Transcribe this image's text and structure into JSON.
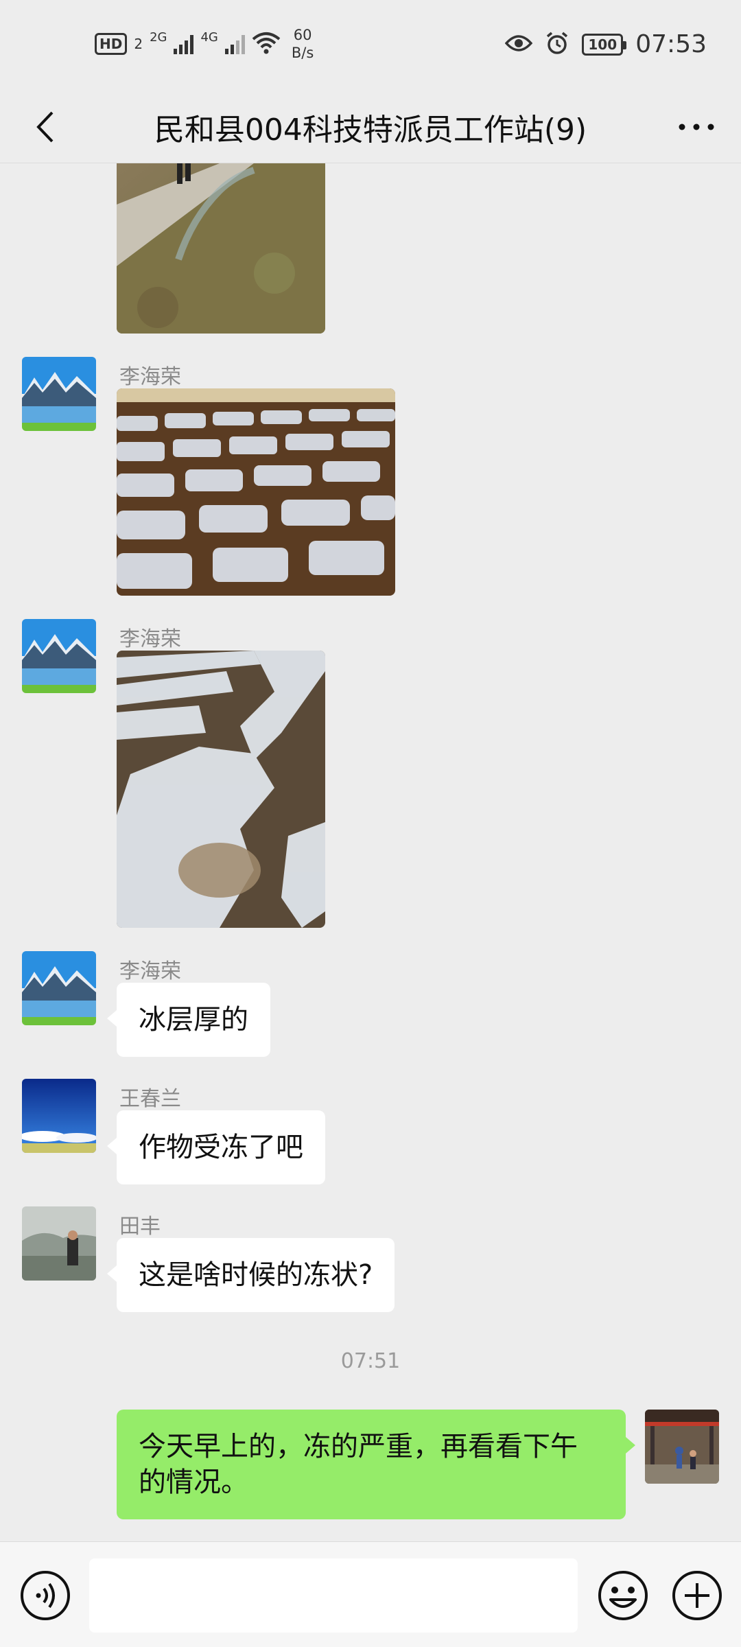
{
  "status_bar": {
    "hd": "HD",
    "sim": "2",
    "net1": "2G",
    "net2": "4G",
    "speed_value": "60",
    "speed_unit": "B/s",
    "battery": "100",
    "time": "07:53",
    "icons": [
      "signal-icon",
      "wifi-icon",
      "eye-icon",
      "alarm-icon",
      "battery-icon"
    ]
  },
  "header": {
    "title": "民和县004科技特派员工作站(9)",
    "back_icon": "chevron-left-icon",
    "more_label": "···"
  },
  "messages": [
    {
      "type": "image",
      "sender": "",
      "description_icon": "photo-field-path"
    },
    {
      "type": "image",
      "sender": "李海荣"
    },
    {
      "type": "image",
      "sender": "李海荣"
    },
    {
      "type": "text",
      "sender": "李海荣",
      "text": "冰层厚的"
    },
    {
      "type": "text",
      "sender": "王春兰",
      "text": "作物受冻了吧"
    },
    {
      "type": "text",
      "sender": "田丰",
      "text": "这是啥时候的冻状?"
    },
    {
      "type": "time",
      "text": "07:51"
    },
    {
      "type": "text",
      "sender": "self",
      "text": "今天早上的，冻的严重，再看看下午的情况。"
    }
  ],
  "input_bar": {
    "placeholder": "",
    "icons": [
      "voice-icon",
      "emoji-icon",
      "plus-icon"
    ]
  },
  "colors": {
    "background": "#ededed",
    "own_bubble": "#95ec69",
    "other_bubble": "#ffffff",
    "muted_text": "#8a8a8a"
  }
}
